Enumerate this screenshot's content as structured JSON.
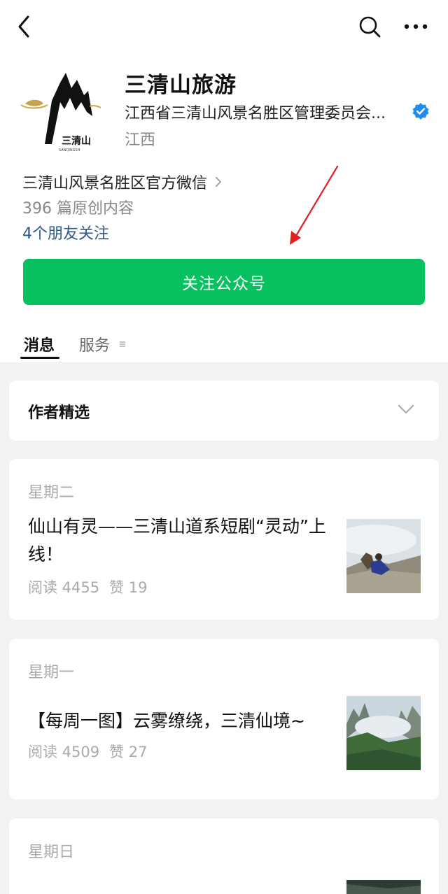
{
  "header": {
    "back_icon": "chevron-left-icon",
    "search_icon": "search-icon",
    "more_icon": "more-horizontal-icon"
  },
  "profile": {
    "logo_text": "三清山",
    "logo_subtext": "SANQINGSH",
    "name": "三清山旅游",
    "organization": "江西省三清山风景名胜区管理委员会...",
    "verified": true,
    "region": "江西",
    "description": "三清山风景名胜区官方微信",
    "article_count": "396 篇原创内容",
    "friends_following": "4个朋友关注"
  },
  "follow_button": {
    "label": "关注公众号",
    "color": "#07c160"
  },
  "tabs": [
    {
      "label": "消息",
      "active": true
    },
    {
      "label": "服务",
      "active": false
    }
  ],
  "featured": {
    "label": "作者精选"
  },
  "articles": [
    {
      "day": "星期二",
      "title": "仙山有灵——三清山道系短剧“灵动”上线！",
      "reads": "阅读 4455",
      "likes": "赞 19"
    },
    {
      "day": "星期一",
      "title": "【每周一图】云雾缭绕，三清仙境~",
      "reads": "阅读 4509",
      "likes": "赞 27"
    },
    {
      "day": "星期日"
    }
  ],
  "colors": {
    "accent": "#07c160",
    "link": "#2f5a8c",
    "verified": "#1f8cf0",
    "annotation_arrow": "#e02020"
  }
}
